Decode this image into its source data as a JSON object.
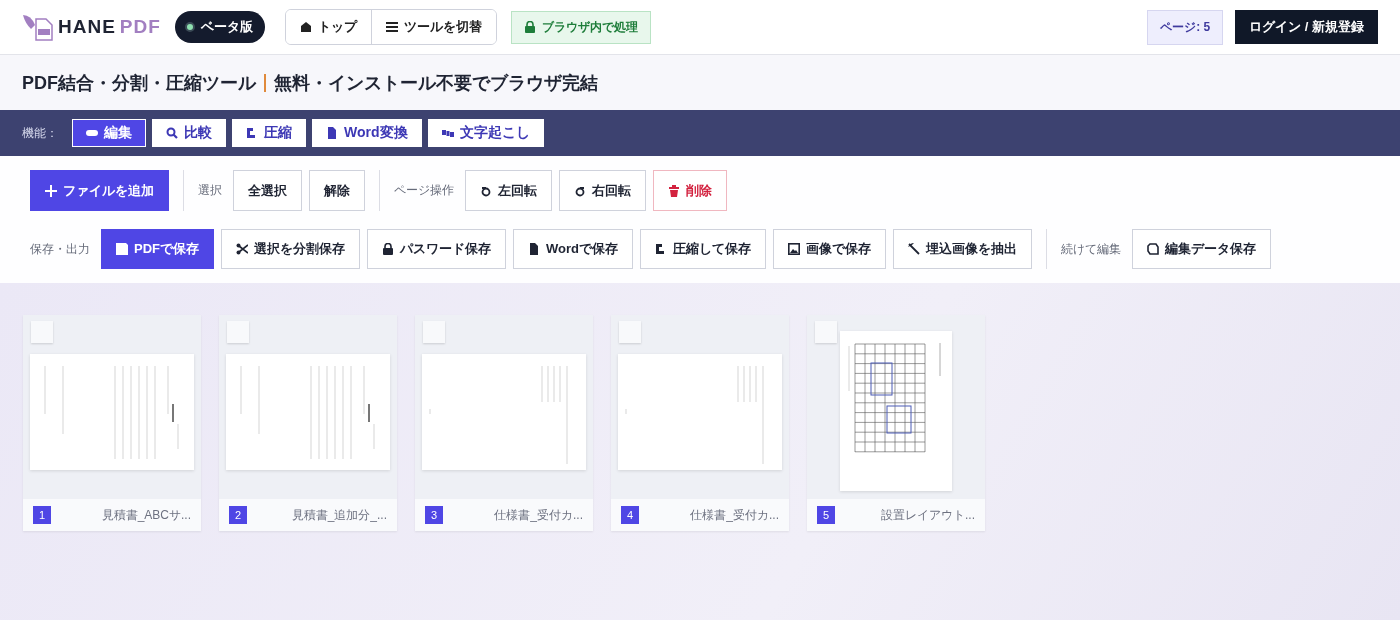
{
  "header": {
    "logo": {
      "word_1": "HANE",
      "word_2": "PDF"
    },
    "beta_badge": "ベータ版",
    "nav": [
      {
        "label": "トップ"
      },
      {
        "label": "ツールを切替"
      }
    ],
    "privacy_badge": "ブラウザ内で処理",
    "page_count": "ページ: 5",
    "login_button": "ログイン / 新規登録"
  },
  "title": {
    "main": "PDF結合・分割・圧縮ツール",
    "sub": "無料・インストール不要でブラウザ完結"
  },
  "features": {
    "label": "機能：",
    "tabs": [
      {
        "label": "編集",
        "selected": true
      },
      {
        "label": "比較",
        "selected": false
      },
      {
        "label": "圧縮",
        "selected": false
      },
      {
        "label": "Word変換",
        "selected": false
      },
      {
        "label": "文字起こし",
        "selected": false
      }
    ]
  },
  "toolbar": {
    "rows": [
      {
        "groups": [
          {
            "buttons": [
              {
                "label": "ファイルを追加",
                "kind": "primary"
              }
            ]
          },
          {
            "label": "選択",
            "buttons": [
              {
                "label": "全選択",
                "kind": "default"
              },
              {
                "label": "解除",
                "kind": "default"
              }
            ]
          },
          {
            "label": "ページ操作",
            "buttons": [
              {
                "label": "左回転",
                "kind": "default"
              },
              {
                "label": "右回転",
                "kind": "default"
              },
              {
                "label": "削除",
                "kind": "danger"
              }
            ]
          }
        ]
      },
      {
        "groups": [
          {
            "label": "保存・出力",
            "buttons": [
              {
                "label": "PDFで保存",
                "kind": "primary"
              },
              {
                "label": "選択を分割保存",
                "kind": "default"
              },
              {
                "label": "パスワード保存",
                "kind": "default"
              },
              {
                "label": "Wordで保存",
                "kind": "default"
              },
              {
                "label": "圧縮して保存",
                "kind": "default"
              },
              {
                "label": "画像で保存",
                "kind": "default"
              },
              {
                "label": "埋込画像を抽出",
                "kind": "default"
              }
            ]
          },
          {
            "label": "続けて編集",
            "buttons": [
              {
                "label": "編集データ保存",
                "kind": "default"
              }
            ]
          }
        ]
      }
    ]
  },
  "pages": [
    {
      "number": "1",
      "filename": "見積書_ABCサ...",
      "kind": "landscape",
      "selected": false
    },
    {
      "number": "2",
      "filename": "見積書_追加分_...",
      "kind": "landscape",
      "selected": false
    },
    {
      "number": "3",
      "filename": "仕様書_受付カ...",
      "kind": "landscape",
      "selected": false
    },
    {
      "number": "4",
      "filename": "仕様書_受付カ...",
      "kind": "landscape",
      "selected": false
    },
    {
      "number": "5",
      "filename": "設置レイアウト...",
      "kind": "portrait",
      "selected": false
    }
  ]
}
